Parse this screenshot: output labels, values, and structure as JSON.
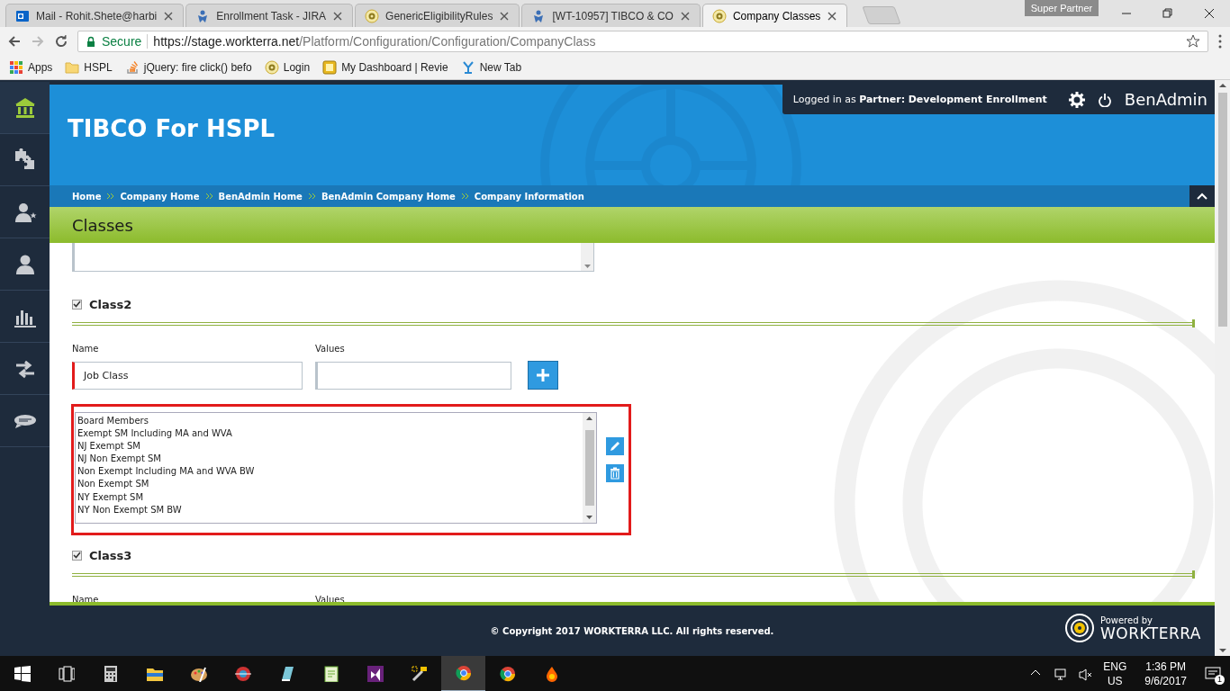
{
  "browser": {
    "tabs": [
      {
        "kind": "outlook",
        "title": "Mail - Rohit.Shete@harbi",
        "selected": false
      },
      {
        "kind": "jira",
        "title": "Enrollment Task - JIRA",
        "selected": false
      },
      {
        "kind": "site",
        "title": "GenericEligibilityRules",
        "selected": false
      },
      {
        "kind": "jira",
        "title": "[WT-10957] TIBCO & CO",
        "selected": false
      },
      {
        "kind": "site",
        "title": "Company Classes",
        "selected": true
      }
    ],
    "profile": "Super Partner",
    "address": {
      "secure": "Secure",
      "host": "https://stage.workterra.net",
      "path": "/Platform/Configuration/Configuration/CompanyClass"
    },
    "bookmarks": [
      {
        "kind": "apps",
        "label": "Apps"
      },
      {
        "kind": "folder",
        "label": "HSPL"
      },
      {
        "kind": "so",
        "label": "jQuery: fire click() befo"
      },
      {
        "kind": "site",
        "label": "Login"
      },
      {
        "kind": "dash",
        "label": "My Dashboard | Revie"
      },
      {
        "kind": "tab",
        "label": "New Tab"
      }
    ]
  },
  "sidebar": {
    "items": [
      {
        "kind": "home",
        "selected": true
      },
      {
        "kind": "puzzle",
        "selected": false
      },
      {
        "kind": "user-star",
        "selected": false
      },
      {
        "kind": "user",
        "selected": false
      },
      {
        "kind": "chart",
        "selected": false
      },
      {
        "kind": "swap",
        "selected": false
      },
      {
        "kind": "chat",
        "selected": false
      }
    ]
  },
  "header": {
    "title": "TIBCO For HSPL",
    "login_prefix": "Logged in as",
    "role": "Partner:",
    "user": "Development Enrollment",
    "app": "BenAdmin",
    "breadcrumbs": [
      "Home",
      "Company Home",
      "BenAdmin Home",
      "BenAdmin Company Home",
      "Company Information"
    ]
  },
  "section_title": "Classes",
  "classes": [
    {
      "name": "Class2",
      "checked": true,
      "name_label": "Name",
      "values_label": "Values",
      "name_value": "Job Class",
      "values": [
        "Board Members",
        "Exempt SM Including MA and WVA",
        "NJ Exempt SM",
        "NJ Non Exempt SM",
        "Non Exempt Including MA and WVA BW",
        "Non Exempt SM",
        "NY Exempt SM",
        "NY Non Exempt SM BW"
      ]
    },
    {
      "name": "Class3",
      "checked": true,
      "name_label": "Name",
      "values_label": "Values"
    }
  ],
  "footer": {
    "copyright": "© Copyright 2017 WORKTERRA LLC. All rights reserved.",
    "powered_by": "Powered by",
    "brand": "WORKTERRA"
  },
  "taskbar": {
    "language": "ENG",
    "region": "US",
    "time": "1:36 PM",
    "date": "9/6/2017",
    "notifications": "1"
  }
}
